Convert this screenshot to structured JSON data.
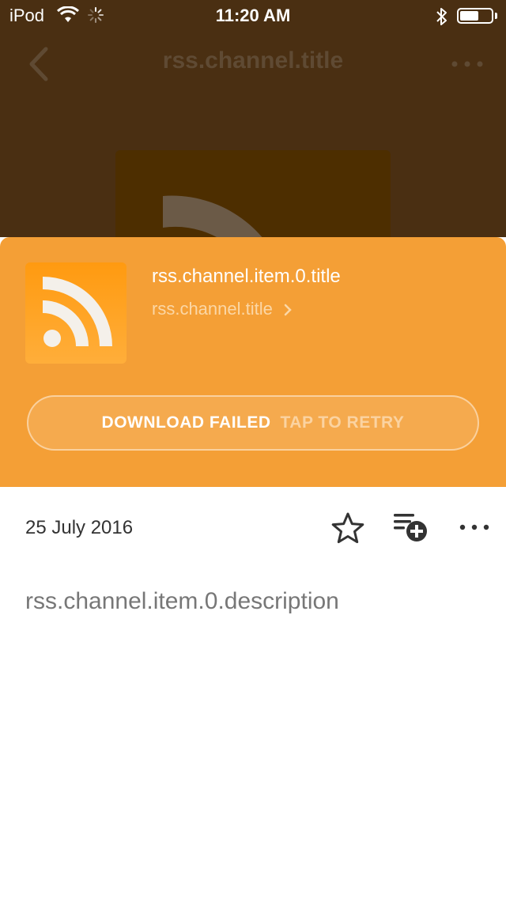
{
  "status_bar": {
    "carrier": "iPod",
    "time": "11:20 AM",
    "battery_level": 0.6
  },
  "navbar": {
    "title": "rss.channel.title",
    "back_icon": "chevron-left-icon",
    "more_icon": "more-horizontal-icon"
  },
  "episode": {
    "title": "rss.channel.item.0.title",
    "channel": "rss.channel.title",
    "thumbnail_icon": "rss-icon",
    "download_status": "DOWNLOAD FAILED",
    "retry_label": "TAP TO RETRY"
  },
  "actions": {
    "date": "25 July 2016",
    "star_icon": "star-outline-icon",
    "queue_icon": "add-to-queue-icon",
    "more_icon": "more-horizontal-icon"
  },
  "description": "rss.channel.item.0.description",
  "colors": {
    "accent": "#f49f36",
    "backdrop": "#4a2f12",
    "thumbnail": "#ffa125"
  }
}
